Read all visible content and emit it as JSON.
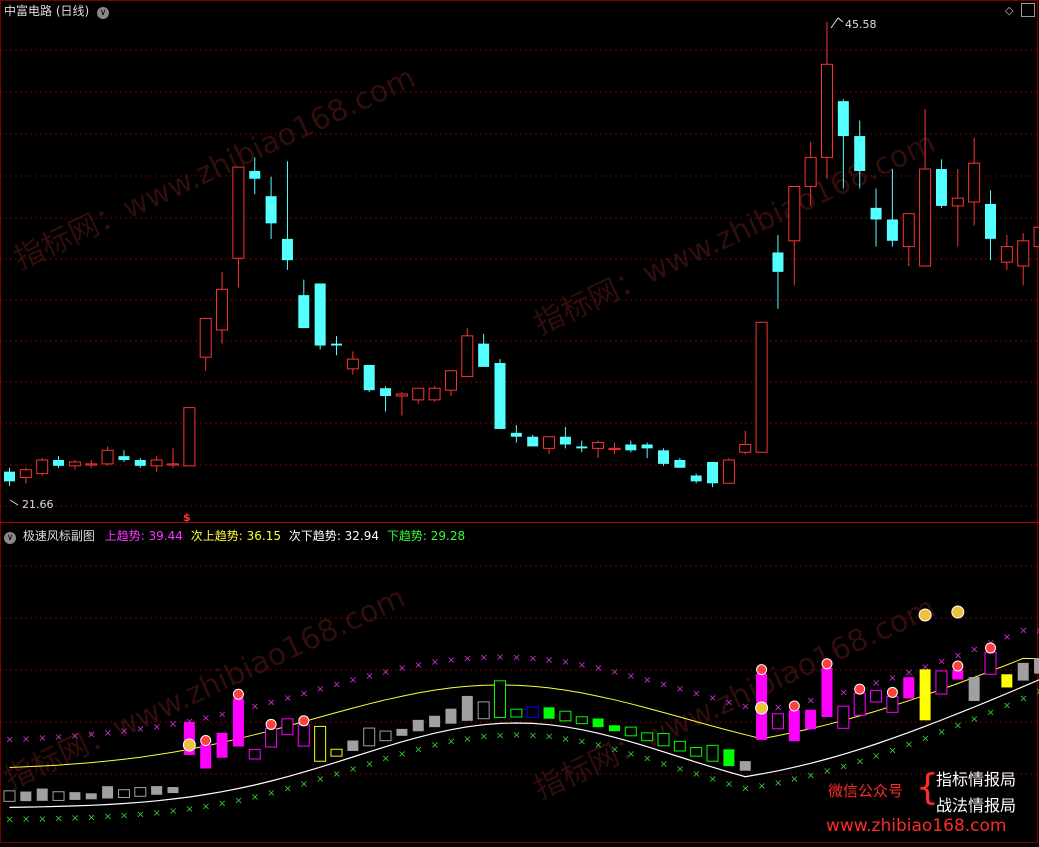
{
  "main_panel": {
    "title": "中富电路 (日线)",
    "high_label": "45.58",
    "low_label": "21.66"
  },
  "sub_panel": {
    "title": "极速风标副图",
    "labels": [
      {
        "key": "上趋势",
        "value": "39.44",
        "color": "#ff33ff"
      },
      {
        "key": "次上趋势",
        "value": "36.15",
        "color": "#ffff33"
      },
      {
        "key": "次下趋势",
        "value": "32.94",
        "color": "#ffffff"
      },
      {
        "key": "下趋势",
        "value": "29.28",
        "color": "#33ff33"
      }
    ]
  },
  "watermark": {
    "text": "指标网：www.zhibiao168.com",
    "footer_url": "www.zhibiao168.com",
    "wechat_label": "微信公众号",
    "brand_1": "指标情报局",
    "brand_2": "战法情报局"
  },
  "colors": {
    "up": "#ff3232",
    "down": "#54ffff",
    "grid": "#7a0000",
    "magenta": "#ff00ff",
    "yellow": "#ffff00",
    "green": "#00ff00",
    "blue": "#0000ff",
    "gray": "#a0a0a0"
  },
  "chart_data": {
    "type": "candlestick",
    "price_high": 45.58,
    "price_low": 21.66,
    "candles": [
      {
        "o": 22.4,
        "h": 22.6,
        "l": 21.66,
        "c": 21.9
      },
      {
        "o": 22.1,
        "h": 22.6,
        "l": 21.8,
        "c": 22.5
      },
      {
        "o": 22.3,
        "h": 23.1,
        "l": 22.2,
        "c": 23.0
      },
      {
        "o": 23.0,
        "h": 23.2,
        "l": 22.6,
        "c": 22.7
      },
      {
        "o": 22.7,
        "h": 23.0,
        "l": 22.5,
        "c": 22.9
      },
      {
        "o": 22.8,
        "h": 23.0,
        "l": 22.6,
        "c": 22.8
      },
      {
        "o": 22.8,
        "h": 23.7,
        "l": 22.7,
        "c": 23.5
      },
      {
        "o": 23.2,
        "h": 23.5,
        "l": 22.9,
        "c": 23.0
      },
      {
        "o": 23.0,
        "h": 23.1,
        "l": 22.6,
        "c": 22.7
      },
      {
        "o": 22.7,
        "h": 23.2,
        "l": 22.4,
        "c": 23.0
      },
      {
        "o": 22.8,
        "h": 23.6,
        "l": 22.6,
        "c": 22.8
      },
      {
        "o": 22.7,
        "h": 25.7,
        "l": 22.7,
        "c": 25.7
      },
      {
        "o": 28.3,
        "h": 30.3,
        "l": 27.6,
        "c": 30.3
      },
      {
        "o": 29.7,
        "h": 32.7,
        "l": 29.0,
        "c": 31.8
      },
      {
        "o": 33.4,
        "h": 38.0,
        "l": 31.9,
        "c": 38.1
      },
      {
        "o": 37.9,
        "h": 38.6,
        "l": 36.7,
        "c": 37.5
      },
      {
        "o": 36.6,
        "h": 37.6,
        "l": 34.4,
        "c": 35.2
      },
      {
        "o": 34.4,
        "h": 38.4,
        "l": 32.8,
        "c": 33.3
      },
      {
        "o": 31.5,
        "h": 32.3,
        "l": 29.8,
        "c": 29.8
      },
      {
        "o": 32.1,
        "h": 32.1,
        "l": 28.7,
        "c": 28.9
      },
      {
        "o": 29.0,
        "h": 29.4,
        "l": 28.4,
        "c": 28.9
      },
      {
        "o": 27.7,
        "h": 28.6,
        "l": 27.4,
        "c": 28.2
      },
      {
        "o": 27.9,
        "h": 27.9,
        "l": 26.5,
        "c": 26.6
      },
      {
        "o": 26.7,
        "h": 26.8,
        "l": 25.5,
        "c": 26.3
      },
      {
        "o": 26.3,
        "h": 26.5,
        "l": 25.3,
        "c": 26.4
      },
      {
        "o": 26.1,
        "h": 26.7,
        "l": 25.9,
        "c": 26.7
      },
      {
        "o": 26.1,
        "h": 26.8,
        "l": 26.0,
        "c": 26.7
      },
      {
        "o": 26.6,
        "h": 27.6,
        "l": 26.3,
        "c": 27.6
      },
      {
        "o": 27.3,
        "h": 29.8,
        "l": 27.3,
        "c": 29.4
      },
      {
        "o": 29.0,
        "h": 29.5,
        "l": 27.8,
        "c": 27.8
      },
      {
        "o": 28.0,
        "h": 28.2,
        "l": 24.6,
        "c": 24.6
      },
      {
        "o": 24.4,
        "h": 24.8,
        "l": 23.9,
        "c": 24.2
      },
      {
        "o": 24.2,
        "h": 24.3,
        "l": 23.7,
        "c": 23.7
      },
      {
        "o": 23.6,
        "h": 24.0,
        "l": 23.3,
        "c": 24.2
      },
      {
        "o": 24.2,
        "h": 24.7,
        "l": 23.6,
        "c": 23.8
      },
      {
        "o": 23.7,
        "h": 24.0,
        "l": 23.4,
        "c": 23.6
      },
      {
        "o": 23.6,
        "h": 24.0,
        "l": 23.1,
        "c": 23.9
      },
      {
        "o": 23.6,
        "h": 23.9,
        "l": 23.3,
        "c": 23.6
      },
      {
        "o": 23.8,
        "h": 24.0,
        "l": 23.4,
        "c": 23.5
      },
      {
        "o": 23.8,
        "h": 23.9,
        "l": 23.1,
        "c": 23.6
      },
      {
        "o": 23.5,
        "h": 23.6,
        "l": 22.7,
        "c": 22.8
      },
      {
        "o": 23.0,
        "h": 23.1,
        "l": 22.6,
        "c": 22.6
      },
      {
        "o": 22.2,
        "h": 22.3,
        "l": 21.8,
        "c": 21.9
      },
      {
        "o": 22.9,
        "h": 22.9,
        "l": 21.6,
        "c": 21.8
      },
      {
        "o": 21.8,
        "h": 23.1,
        "l": 21.8,
        "c": 23.0
      },
      {
        "o": 23.4,
        "h": 24.5,
        "l": 23.3,
        "c": 23.8
      },
      {
        "o": 23.4,
        "h": 30.1,
        "l": 23.4,
        "c": 30.1
      },
      {
        "o": 33.7,
        "h": 34.6,
        "l": 30.8,
        "c": 32.7
      },
      {
        "o": 34.3,
        "h": 35.5,
        "l": 32.0,
        "c": 37.1
      },
      {
        "o": 37.1,
        "h": 39.4,
        "l": 36.1,
        "c": 38.6
      },
      {
        "o": 38.6,
        "h": 45.58,
        "l": 37.5,
        "c": 43.4
      },
      {
        "o": 41.5,
        "h": 41.6,
        "l": 37.0,
        "c": 39.7
      },
      {
        "o": 39.7,
        "h": 40.5,
        "l": 37.0,
        "c": 37.9
      },
      {
        "o": 36.0,
        "h": 37.0,
        "l": 34.0,
        "c": 35.4
      },
      {
        "o": 35.4,
        "h": 38.0,
        "l": 34.0,
        "c": 34.3
      },
      {
        "o": 34.0,
        "h": 34.9,
        "l": 33.0,
        "c": 35.7
      },
      {
        "o": 33.0,
        "h": 41.1,
        "l": 35.3,
        "c": 38.0
      },
      {
        "o": 38.0,
        "h": 38.5,
        "l": 36.0,
        "c": 36.1
      },
      {
        "o": 36.1,
        "h": 38.0,
        "l": 34.0,
        "c": 36.5
      },
      {
        "o": 36.3,
        "h": 39.6,
        "l": 35.1,
        "c": 38.3
      },
      {
        "o": 36.2,
        "h": 36.9,
        "l": 33.3,
        "c": 34.4
      },
      {
        "o": 33.2,
        "h": 34.6,
        "l": 32.8,
        "c": 34.0
      },
      {
        "o": 33.0,
        "h": 34.7,
        "l": 32.0,
        "c": 34.3
      },
      {
        "o": 34.0,
        "h": 35.2,
        "l": 32.3,
        "c": 35.0
      }
    ]
  }
}
